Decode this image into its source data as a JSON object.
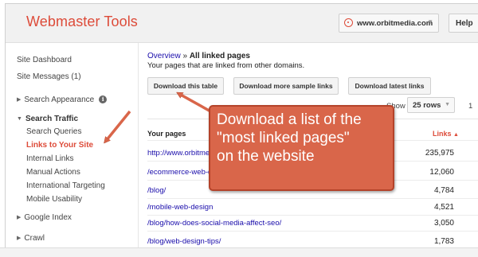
{
  "header": {
    "app_title": "Webmaster Tools",
    "site_selector": "www.orbitmedia.com",
    "help_label": "Help"
  },
  "sidebar": {
    "items": [
      {
        "label": "Site Dashboard"
      },
      {
        "label": "Site Messages (1)"
      },
      {
        "label": "Search Appearance"
      },
      {
        "label": "Search Traffic"
      },
      {
        "label": "Search Queries"
      },
      {
        "label": "Links to Your Site"
      },
      {
        "label": "Internal Links"
      },
      {
        "label": "Manual Actions"
      },
      {
        "label": "International Targeting"
      },
      {
        "label": "Mobile Usability"
      },
      {
        "label": "Google Index"
      },
      {
        "label": "Crawl"
      }
    ]
  },
  "main": {
    "breadcrumb_link": "Overview",
    "breadcrumb_sep": "»",
    "breadcrumb_current": "All linked pages",
    "subtitle": "Your pages that are linked from other domains.",
    "buttons": {
      "download_table": "Download this table",
      "download_sample": "Download more sample links",
      "download_latest": "Download latest links"
    },
    "show_label": "Show",
    "rows_selected": "25 rows",
    "pager": "1",
    "table": {
      "col_pages": "Your pages",
      "col_links": "Links",
      "rows": [
        {
          "page": "http://www.orbitmedia.com/",
          "links": "235,975"
        },
        {
          "page": "/ecommerce-web-design/",
          "links": "12,060"
        },
        {
          "page": "/blog/",
          "links": "4,784"
        },
        {
          "page": "/mobile-web-design",
          "links": "4,521"
        },
        {
          "page": "/blog/how-does-social-media-affect-seo/",
          "links": "3,050"
        },
        {
          "page": "/blog/web-design-tips/",
          "links": "1,783"
        }
      ]
    }
  },
  "callout": {
    "line1": "Download a list of the",
    "line2": "\"most linked pages\"",
    "line3": "on the website"
  },
  "colors": {
    "brand_red": "#dd4b39",
    "callout_fill": "#d9664a",
    "link_blue": "#1a0dab"
  }
}
